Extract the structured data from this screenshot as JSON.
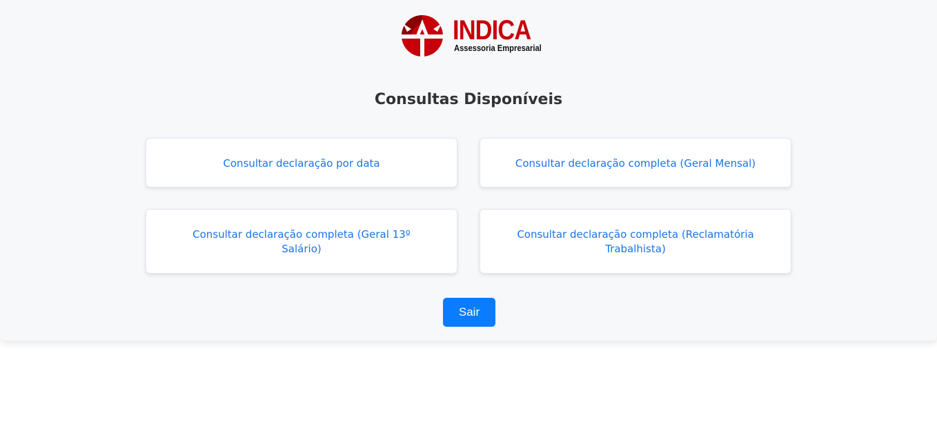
{
  "logo": {
    "brand": "INDICA",
    "tagline": "Assessoria Empresarial",
    "colors": {
      "brand_red": "#c8000a",
      "dark_red": "#8b0000",
      "tagline": "#111111"
    }
  },
  "page": {
    "title": "Consultas Disponíveis"
  },
  "options": [
    {
      "label": "Consultar declaração por data"
    },
    {
      "label": "Consultar declaração completa (Geral Mensal)"
    },
    {
      "label": "Consultar declaração completa (Geral 13º Salário)"
    },
    {
      "label": "Consultar declaração completa (Reclamatória Trabalhista)"
    }
  ],
  "actions": {
    "exit_label": "Sair"
  },
  "colors": {
    "accent": "#0a7cff",
    "link": "#1a73e8",
    "panel_bg": "#f7f8fa",
    "title": "#333333"
  }
}
